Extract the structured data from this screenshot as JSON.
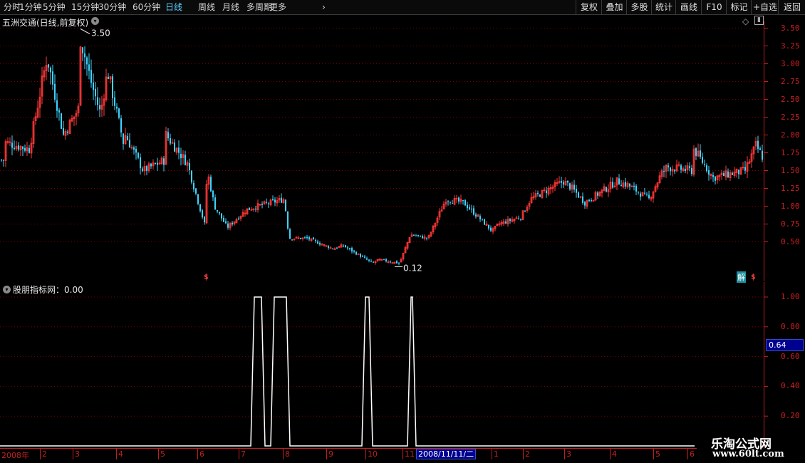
{
  "toolbar": {
    "periods": [
      "分时",
      "1分钟",
      "5分钟",
      "15分钟",
      "30分钟",
      "60分钟",
      "日线",
      "周线",
      "月线",
      "多周期",
      "更多"
    ],
    "active_period": "日线",
    "right_buttons": [
      "复权",
      "叠加",
      "多股",
      "统计",
      "画线",
      "F10",
      "标记",
      "+自选",
      "返回"
    ]
  },
  "main_panel": {
    "title": "五洲交通(日线,前复权)",
    "high_marker": "3.50",
    "low_marker": "0.12",
    "y_ticks": [
      "3.50",
      "3.25",
      "3.00",
      "2.75",
      "2.50",
      "2.25",
      "2.00",
      "1.75",
      "1.50",
      "1.25",
      "1.00",
      "0.75",
      "0.50"
    ],
    "event_markers": [
      "$",
      "解",
      "$"
    ],
    "colors": {
      "up": "#ff3838",
      "down": "#3fd4ff",
      "grid": "#7a0000",
      "axis": "#c02020"
    }
  },
  "indicator_panel": {
    "title": "股朋指标网：0.00",
    "current_value_tag": "0.64",
    "y_ticks": [
      "1.00",
      "0.80",
      "0.60",
      "0.40",
      "0.20"
    ]
  },
  "date_axis": {
    "labels": [
      "2008年",
      "2",
      "3",
      "4",
      "5",
      "6",
      "7",
      "8",
      "9",
      "10",
      "11",
      "1",
      "2",
      "3",
      "4",
      "5",
      "6"
    ],
    "selected_date": "2008/11/11/二"
  },
  "watermark": {
    "line1": "乐淘公式网",
    "line2": "www.60lt.com"
  },
  "chart_data": [
    {
      "type": "candlestick",
      "title": "五洲交通(日线,前复权)",
      "y_range": [
        0.12,
        3.5
      ],
      "annotations": [
        {
          "label": "3.50",
          "kind": "high"
        },
        {
          "label": "0.12",
          "kind": "low"
        }
      ],
      "close_trend": [
        {
          "period": "2008-01",
          "close": 1.9
        },
        {
          "period": "2008-02",
          "close": 3.1
        },
        {
          "period": "2008-03",
          "close": 2.4
        },
        {
          "period": "2008-04",
          "close": 1.9
        },
        {
          "period": "2008-05",
          "close": 1.65
        },
        {
          "period": "2008-06",
          "close": 0.75
        },
        {
          "period": "2008-07",
          "close": 0.95
        },
        {
          "period": "2008-08",
          "close": 0.55
        },
        {
          "period": "2008-09",
          "close": 0.4
        },
        {
          "period": "2008-10",
          "close": 0.2
        },
        {
          "period": "2008-11",
          "close": 0.6
        },
        {
          "period": "2009-01",
          "close": 0.75
        },
        {
          "period": "2009-02",
          "close": 1.1
        },
        {
          "period": "2009-03",
          "close": 1.25
        },
        {
          "period": "2009-04",
          "close": 1.35
        },
        {
          "period": "2009-05",
          "close": 1.45
        },
        {
          "period": "2009-06",
          "close": 1.8
        }
      ]
    },
    {
      "type": "line",
      "title": "股朋指标网",
      "y_range": [
        0,
        1
      ],
      "pulses_value": 1.0,
      "baseline_value": 0.0,
      "pulse_months": [
        "2008-07",
        "2008-08",
        "2008-10",
        "2008-11"
      ]
    }
  ]
}
